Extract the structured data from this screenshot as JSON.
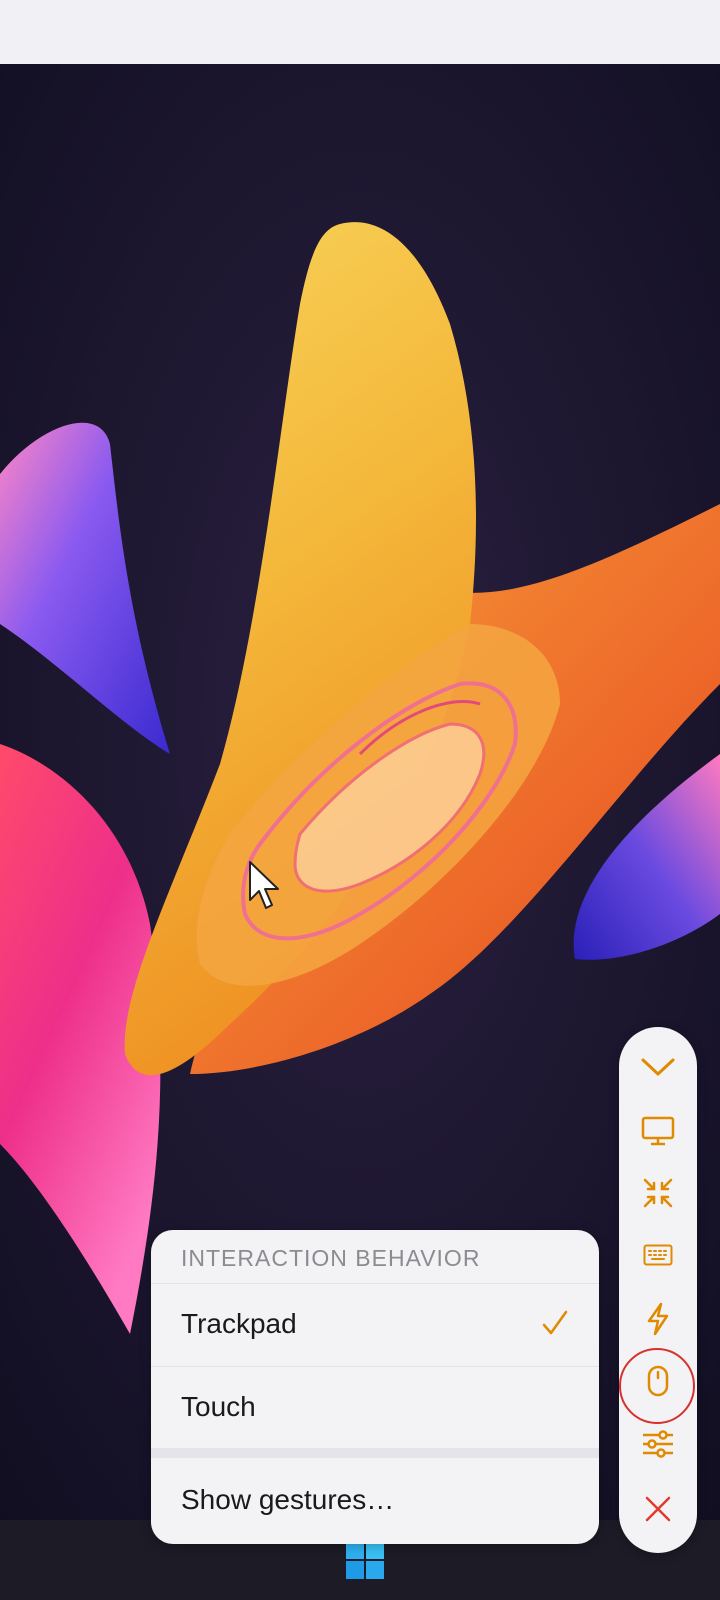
{
  "toolbar": {
    "items": [
      {
        "name": "collapse",
        "icon": "chevron-down-icon"
      },
      {
        "name": "display",
        "icon": "monitor-icon"
      },
      {
        "name": "fit-screen",
        "icon": "shrink-arrows-icon"
      },
      {
        "name": "keyboard",
        "icon": "keyboard-icon"
      },
      {
        "name": "actions",
        "icon": "lightning-icon"
      },
      {
        "name": "mouse",
        "icon": "mouse-icon",
        "highlighted": true
      },
      {
        "name": "settings",
        "icon": "sliders-icon"
      },
      {
        "name": "close",
        "icon": "close-icon"
      }
    ],
    "accent": "#e08a00",
    "highlight_color": "#d8312d"
  },
  "menu": {
    "header": "INTERACTION BEHAVIOR",
    "options": [
      {
        "label": "Trackpad",
        "selected": true
      },
      {
        "label": "Touch",
        "selected": false
      }
    ],
    "footer_action": "Show gestures…"
  },
  "taskbar": {
    "start_icon": "windows-logo-icon"
  },
  "desktop": {
    "cursor_icon": "mouse-pointer-icon"
  }
}
